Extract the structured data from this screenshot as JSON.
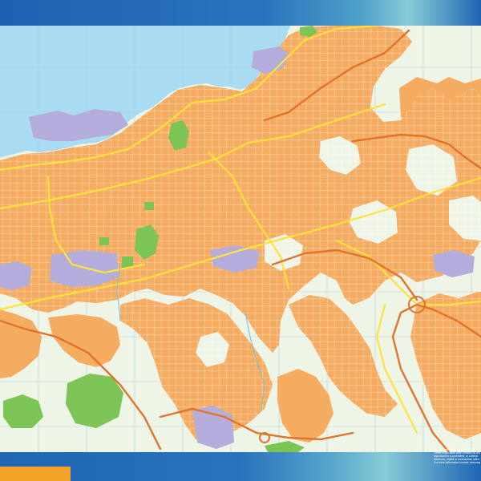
{
  "map": {
    "colors": {
      "frame_blue": "#1f6bb8",
      "frame_teal": "#7fc6d2",
      "sea": "#a9dcf3",
      "land": "#eef4e6",
      "urban": "#f5ab60",
      "industrial": "#b4addb",
      "park": "#7cc455",
      "main_road": "#ffe23a",
      "highway": "#e0742a",
      "grid": "#9fc9df",
      "legend_bar": "#f3a427"
    },
    "credits": [
      "© Copyright Ollebospert 1997-2016",
      "These maps have been created by the",
      "reproduction is prohibited, or a literal",
      "electronic, digital or mechanical, witho",
      "For more information contact: wowmaps"
    ]
  }
}
